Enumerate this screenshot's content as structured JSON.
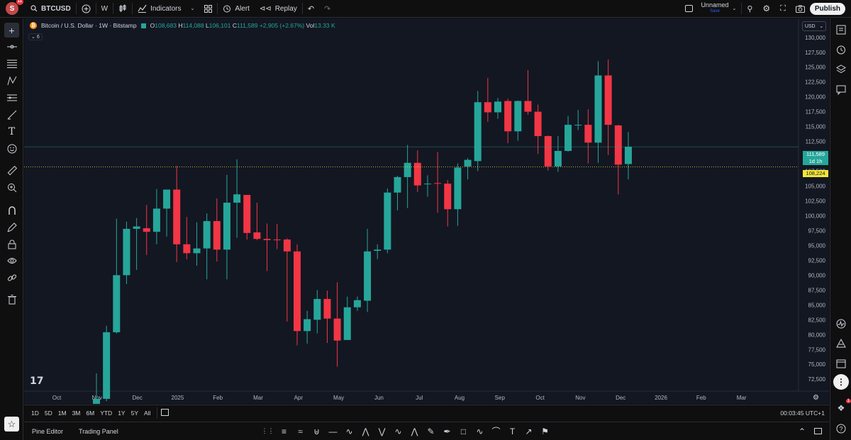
{
  "topbar": {
    "avatar_letter": "S",
    "avatar_badge": "11",
    "symbol": "BTCUSD",
    "interval": "W",
    "indicators_label": "Indicators",
    "alert_label": "Alert",
    "replay_label": "Replay",
    "layout_name": "Unnamed",
    "layout_save": "Save",
    "publish_label": "Publish"
  },
  "legend": {
    "title": "Bitcoin / U.S. Dollar · 1W · Bitstamp",
    "o_label": "O",
    "o_value": "108,683",
    "h_label": "H",
    "h_value": "114,088",
    "l_label": "L",
    "l_value": "106,101",
    "c_label": "C",
    "c_value": "111,589",
    "change": "+2,905 (+2.67%)",
    "vol_label": "Vol",
    "vol_value": "13.33 K",
    "collapsed_count": "6"
  },
  "currency": "USD",
  "price_tags": {
    "last_price": "111,589",
    "countdown": "1d 1h",
    "marker_price": "108,224"
  },
  "timeframes": [
    "1D",
    "5D",
    "1M",
    "3M",
    "6M",
    "YTD",
    "1Y",
    "5Y",
    "All"
  ],
  "clock": "00:03:45 UTC+1",
  "footer": {
    "pine_editor": "Pine Editor",
    "trading_panel": "Trading Panel"
  },
  "notification_badge": "1",
  "colors": {
    "up": "#26a69a",
    "down": "#f23645",
    "background": "#131722",
    "marker": "#f0e63a"
  },
  "chart_data": {
    "type": "candlestick",
    "y_tick_labels": [
      "72,500",
      "75,000",
      "77,500",
      "80,000",
      "82,500",
      "85,000",
      "87,500",
      "90,000",
      "92,500",
      "95,000",
      "97,500",
      "100,000",
      "102,500",
      "105,000",
      "107,500",
      "110,000",
      "112,500",
      "115,000",
      "117,500",
      "120,000",
      "122,500",
      "125,000",
      "127,500",
      "130,000"
    ],
    "ylim": [
      70500,
      132000
    ],
    "x_tick_labels": [
      "Oct",
      "Nov",
      "Dec",
      "2025",
      "Feb",
      "Mar",
      "Apr",
      "May",
      "Jun",
      "Jul",
      "Aug",
      "Sep",
      "Oct",
      "Nov",
      "Dec",
      "2026",
      "Feb",
      "Mar"
    ],
    "candles": [
      {
        "o": 67000,
        "h": 73500,
        "l": 66000,
        "c": 69200
      },
      {
        "o": 69200,
        "h": 81500,
        "l": 68800,
        "c": 80400
      },
      {
        "o": 80400,
        "h": 99500,
        "l": 80200,
        "c": 90000
      },
      {
        "o": 90000,
        "h": 99000,
        "l": 88500,
        "c": 97800
      },
      {
        "o": 97800,
        "h": 99600,
        "l": 90900,
        "c": 98200
      },
      {
        "o": 97900,
        "h": 101800,
        "l": 93400,
        "c": 97300
      },
      {
        "o": 97300,
        "h": 104500,
        "l": 95200,
        "c": 101200
      },
      {
        "o": 101200,
        "h": 104400,
        "l": 96500,
        "c": 104400
      },
      {
        "o": 104400,
        "h": 108400,
        "l": 92200,
        "c": 95200
      },
      {
        "o": 95200,
        "h": 99800,
        "l": 92700,
        "c": 93700
      },
      {
        "o": 93700,
        "h": 98900,
        "l": 91600,
        "c": 94500
      },
      {
        "o": 94500,
        "h": 100400,
        "l": 89300,
        "c": 99100
      },
      {
        "o": 99100,
        "h": 102900,
        "l": 92300,
        "c": 94300
      },
      {
        "o": 94300,
        "h": 106900,
        "l": 89300,
        "c": 102200
      },
      {
        "o": 102200,
        "h": 109500,
        "l": 96300,
        "c": 103600
      },
      {
        "o": 103500,
        "h": 103500,
        "l": 96000,
        "c": 97100
      },
      {
        "o": 97200,
        "h": 102200,
        "l": 95900,
        "c": 96100
      },
      {
        "o": 96100,
        "h": 98700,
        "l": 90700,
        "c": 95900
      },
      {
        "o": 96000,
        "h": 98600,
        "l": 94400,
        "c": 95900
      },
      {
        "o": 96000,
        "h": 96200,
        "l": 82200,
        "c": 94000
      },
      {
        "o": 94000,
        "h": 95200,
        "l": 78200,
        "c": 80600
      },
      {
        "o": 80600,
        "h": 84000,
        "l": 78500,
        "c": 82600
      },
      {
        "o": 82500,
        "h": 87500,
        "l": 80200,
        "c": 86000
      },
      {
        "o": 86000,
        "h": 87400,
        "l": 78600,
        "c": 82700
      },
      {
        "o": 82700,
        "h": 88800,
        "l": 74600,
        "c": 79000
      },
      {
        "o": 79100,
        "h": 86400,
        "l": 79100,
        "c": 84600
      },
      {
        "o": 84600,
        "h": 86400,
        "l": 84000,
        "c": 85800
      },
      {
        "o": 85700,
        "h": 97800,
        "l": 83800,
        "c": 94000
      },
      {
        "o": 94100,
        "h": 95200,
        "l": 92700,
        "c": 94300
      },
      {
        "o": 94300,
        "h": 104600,
        "l": 93700,
        "c": 103900
      },
      {
        "o": 103900,
        "h": 106700,
        "l": 100900,
        "c": 106500
      },
      {
        "o": 106500,
        "h": 111900,
        "l": 101300,
        "c": 108900
      },
      {
        "o": 108900,
        "h": 111000,
        "l": 104000,
        "c": 105100
      },
      {
        "o": 105300,
        "h": 106800,
        "l": 103200,
        "c": 105400
      },
      {
        "o": 105500,
        "h": 110700,
        "l": 100500,
        "c": 105400
      },
      {
        "o": 105400,
        "h": 106000,
        "l": 98200,
        "c": 101100
      },
      {
        "o": 101100,
        "h": 108800,
        "l": 98300,
        "c": 108100
      },
      {
        "o": 108300,
        "h": 109700,
        "l": 106100,
        "c": 109400
      },
      {
        "o": 109200,
        "h": 121000,
        "l": 107500,
        "c": 119100
      },
      {
        "o": 119100,
        "h": 123200,
        "l": 115800,
        "c": 117400
      },
      {
        "o": 117400,
        "h": 119800,
        "l": 116300,
        "c": 119200
      },
      {
        "o": 119300,
        "h": 119700,
        "l": 112200,
        "c": 114200
      },
      {
        "o": 114200,
        "h": 119400,
        "l": 112600,
        "c": 119300
      },
      {
        "o": 119300,
        "h": 124500,
        "l": 117000,
        "c": 117500
      },
      {
        "o": 117500,
        "h": 118700,
        "l": 110400,
        "c": 113400
      },
      {
        "o": 113400,
        "h": 113500,
        "l": 107600,
        "c": 108300
      },
      {
        "o": 108300,
        "h": 113400,
        "l": 107400,
        "c": 110900
      },
      {
        "o": 110900,
        "h": 116800,
        "l": 110800,
        "c": 115300
      },
      {
        "o": 115200,
        "h": 117800,
        "l": 114400,
        "c": 115300
      },
      {
        "o": 115300,
        "h": 117900,
        "l": 108800,
        "c": 112300
      },
      {
        "o": 112300,
        "h": 126000,
        "l": 108900,
        "c": 123600
      },
      {
        "o": 123600,
        "h": 126300,
        "l": 110200,
        "c": 115300
      },
      {
        "o": 115200,
        "h": 115300,
        "l": 103600,
        "c": 108600
      },
      {
        "o": 108700,
        "h": 114100,
        "l": 106100,
        "c": 111600
      }
    ]
  }
}
